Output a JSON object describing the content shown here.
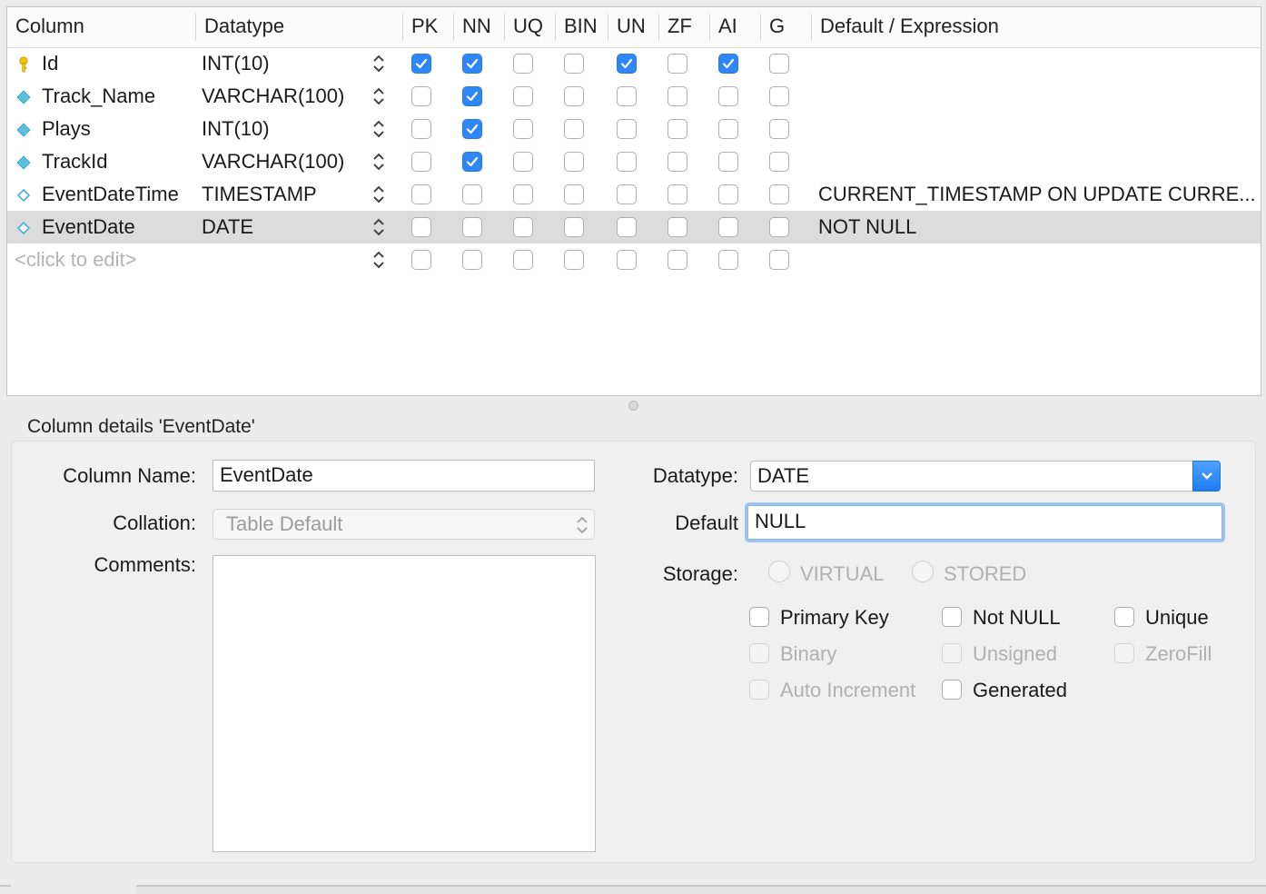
{
  "columns_header": {
    "column": "Column",
    "datatype": "Datatype",
    "pk": "PK",
    "nn": "NN",
    "uq": "UQ",
    "bin": "BIN",
    "un": "UN",
    "zf": "ZF",
    "ai": "AI",
    "g": "G",
    "default": "Default / Expression"
  },
  "rows": [
    {
      "name": "Id",
      "icon": "key-icon",
      "datatype": "INT(10)",
      "flags": [
        true,
        true,
        false,
        false,
        true,
        false,
        true,
        false
      ],
      "default": "",
      "selected": false
    },
    {
      "name": "Track_Name",
      "icon": "diamond-icon",
      "datatype": "VARCHAR(100)",
      "flags": [
        false,
        true,
        false,
        false,
        false,
        false,
        false,
        false
      ],
      "default": "",
      "selected": false
    },
    {
      "name": "Plays",
      "icon": "diamond-icon",
      "datatype": "INT(10)",
      "flags": [
        false,
        true,
        false,
        false,
        false,
        false,
        false,
        false
      ],
      "default": "",
      "selected": false
    },
    {
      "name": "TrackId",
      "icon": "diamond-icon",
      "datatype": "VARCHAR(100)",
      "flags": [
        false,
        true,
        false,
        false,
        false,
        false,
        false,
        false
      ],
      "default": "",
      "selected": false
    },
    {
      "name": "EventDateTime",
      "icon": "diamond-outline-icon",
      "datatype": "TIMESTAMP",
      "flags": [
        false,
        false,
        false,
        false,
        false,
        false,
        false,
        false
      ],
      "default": "CURRENT_TIMESTAMP ON UPDATE CURRE...",
      "selected": false
    },
    {
      "name": "EventDate",
      "icon": "diamond-outline-icon",
      "datatype": "DATE",
      "flags": [
        false,
        false,
        false,
        false,
        false,
        false,
        false,
        false
      ],
      "default": "NOT NULL",
      "selected": true
    }
  ],
  "new_row": {
    "placeholder": "<click to edit>"
  },
  "details": {
    "title": "Column details 'EventDate'",
    "column_name_label": "Column Name:",
    "column_name_value": "EventDate",
    "collation_label": "Collation:",
    "collation_value": "Table Default",
    "comments_label": "Comments:",
    "comments_value": "",
    "datatype_label": "Datatype:",
    "datatype_value": "DATE",
    "default_label": "Default",
    "default_value": "NULL",
    "storage_label": "Storage:",
    "virtual_label": "VIRTUAL",
    "stored_label": "STORED",
    "options": {
      "primary_key": "Primary Key",
      "not_null": "Not NULL",
      "unique": "Unique",
      "binary": "Binary",
      "unsigned": "Unsigned",
      "zerofill": "ZeroFill",
      "auto_increment": "Auto Increment",
      "generated": "Generated"
    }
  },
  "colors": {
    "accent": "#2f86f6",
    "selected_row": "#dcdcdc",
    "focus_ring": "#9cc4f3",
    "key_icon": "#f2c200",
    "diamond_icon": "#5bbfe0"
  }
}
